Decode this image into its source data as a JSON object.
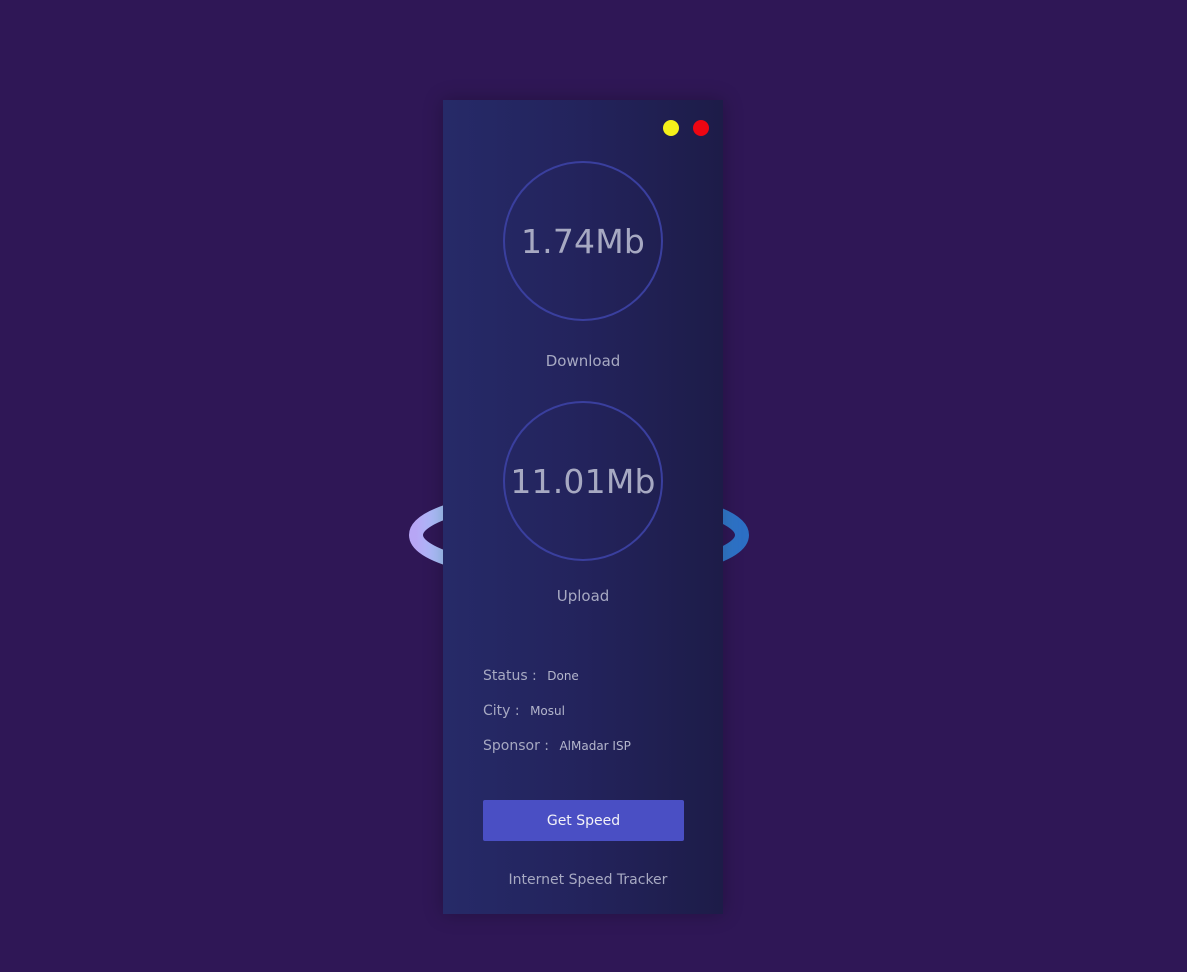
{
  "window": {
    "minimize_color": "#f5f01a",
    "close_color": "#ee0612",
    "minimize_icon": "yellow-dot-icon",
    "close_icon": "red-dot-icon"
  },
  "download": {
    "value": "1.74Mb",
    "label": "Download"
  },
  "upload": {
    "value": "11.01Mb",
    "label": "Upload"
  },
  "info": {
    "status_key": "Status  :",
    "status_value": "Done",
    "city_key": "City :",
    "city_value": "Mosul",
    "sponsor_key": "Sponsor :",
    "sponsor_value": "AlMadar ISP"
  },
  "actions": {
    "get_speed_label": "Get Speed"
  },
  "footer": {
    "app_title": "Internet Speed Tracker"
  },
  "colors": {
    "background": "#2f1756",
    "accent": "#4a4fc4",
    "ring_light": "#a8d8ff",
    "ring_dark": "#2f8fd8"
  }
}
